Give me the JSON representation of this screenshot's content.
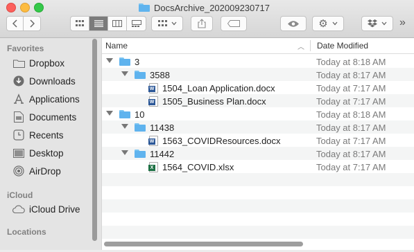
{
  "window": {
    "title": "DocsArchive_202009230717"
  },
  "toolbar": {
    "more": "»"
  },
  "sidebar": {
    "favorites_heading": "Favorites",
    "favorites": [
      {
        "label": "Dropbox",
        "icon": "folder-icon"
      },
      {
        "label": "Downloads",
        "icon": "download-icon"
      },
      {
        "label": "Applications",
        "icon": "applications-icon"
      },
      {
        "label": "Documents",
        "icon": "document-icon"
      },
      {
        "label": "Recents",
        "icon": "clock-icon"
      },
      {
        "label": "Desktop",
        "icon": "desktop-icon"
      },
      {
        "label": "AirDrop",
        "icon": "airdrop-icon"
      }
    ],
    "icloud_heading": "iCloud",
    "icloud": [
      {
        "label": "iCloud Drive",
        "icon": "cloud-icon"
      }
    ],
    "locations_heading": "Locations"
  },
  "list": {
    "col_name": "Name",
    "col_date": "Date Modified",
    "rows": [
      {
        "name": "3",
        "date": "Today at 8:18 AM",
        "kind": "folder",
        "level": 0,
        "expanded": true
      },
      {
        "name": "3588",
        "date": "Today at 8:17 AM",
        "kind": "folder",
        "level": 1,
        "expanded": true
      },
      {
        "name": "1504_Loan Application.docx",
        "date": "Today at 7:17 AM",
        "kind": "word",
        "level": 2
      },
      {
        "name": "1505_Business Plan.docx",
        "date": "Today at 7:17 AM",
        "kind": "word",
        "level": 2
      },
      {
        "name": "10",
        "date": "Today at 8:18 AM",
        "kind": "folder",
        "level": 0,
        "expanded": true
      },
      {
        "name": "11438",
        "date": "Today at 8:17 AM",
        "kind": "folder",
        "level": 1,
        "expanded": true
      },
      {
        "name": "1563_COVIDResources.docx",
        "date": "Today at 7:17 AM",
        "kind": "word",
        "level": 2
      },
      {
        "name": "11442",
        "date": "Today at 8:17 AM",
        "kind": "folder",
        "level": 1,
        "expanded": true
      },
      {
        "name": "1564_COVID.xlsx",
        "date": "Today at 7:17 AM",
        "kind": "excel",
        "level": 2
      }
    ]
  }
}
